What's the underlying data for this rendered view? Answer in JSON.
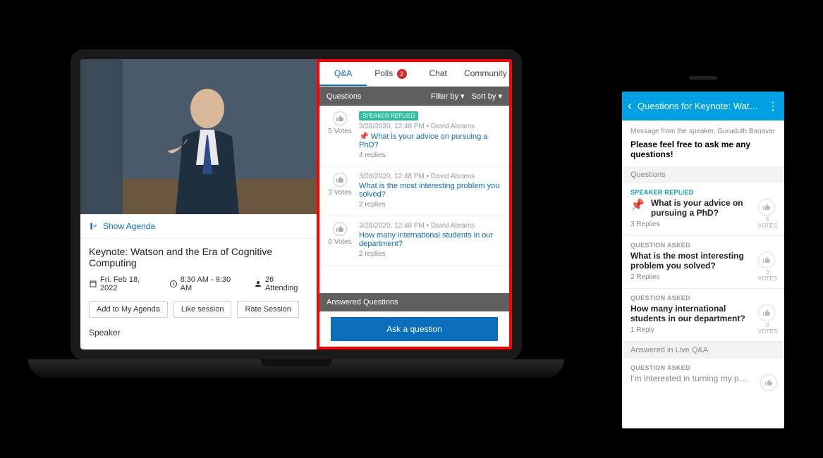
{
  "laptop": {
    "show_agenda": "Show Agenda",
    "session_title": "Keynote: Watson and the Era of Cognitive Computing",
    "date": "Fri. Feb 18, 2022",
    "time": "8:30 AM - 9:30 AM",
    "attending": "26 Attending",
    "buttons": {
      "add": "Add to My Agenda",
      "like": "Like session",
      "rate": "Rate Session"
    },
    "speaker_label": "Speaker",
    "tabs": {
      "qa": "Q&A",
      "polls": "Polls",
      "polls_badge": "2",
      "chat": "Chat",
      "community": "Community"
    },
    "qbar": {
      "title": "Questions",
      "filter": "Filter by ▾",
      "sort": "Sort by ▾"
    },
    "questions": [
      {
        "votes": "5",
        "votes_label": "Votes",
        "tag": "SPEAKER REPLIED",
        "pinned": true,
        "meta": "3/28/2020, 12:48 PM  •  David Abrams",
        "text": "What is your advice on pursuing a PhD?",
        "replies": "4 replies"
      },
      {
        "votes": "3",
        "votes_label": "Votes",
        "meta": "3/28/2020, 12:48 PM  •  David Abrams",
        "text": "What is the most interesting problem you solved?",
        "replies": "2 replies"
      },
      {
        "votes": "0",
        "votes_label": "Votes",
        "meta": "3/28/2020, 12:48 PM  •  David Abrams",
        "text": "How many international students in our department?",
        "replies": "2 replies"
      }
    ],
    "answered_header": "Answered Questions",
    "ask_button": "Ask a question"
  },
  "phone": {
    "header": "Questions for Keynote: Watson…",
    "msg_from": "Message from the speaker, Guruduth Banavar",
    "msg_text": "Please feel free to ask me any questions!",
    "section_questions": "Questions",
    "items": [
      {
        "tag": "SPEAKER REPLIED",
        "tag_class": "",
        "pinned": true,
        "text": "What is your advice on pursuing a PhD?",
        "replies": "3 Replies",
        "votes": "5",
        "votes_label": "VOTES"
      },
      {
        "tag": "QUESTION ASKED",
        "tag_class": "asked",
        "text": "What is the most interesting problem you solved?",
        "replies": "2 Replies",
        "votes": "3",
        "votes_label": "VOTES"
      },
      {
        "tag": "QUESTION ASKED",
        "tag_class": "asked",
        "text": "How many international students in our department?",
        "replies": "1 Reply",
        "votes": "0",
        "votes_label": "VOTES"
      }
    ],
    "answered_section": "Answered in Live Q&A",
    "last": {
      "tag": "QUESTION ASKED",
      "text": "I'm interested in turning my p…"
    }
  }
}
